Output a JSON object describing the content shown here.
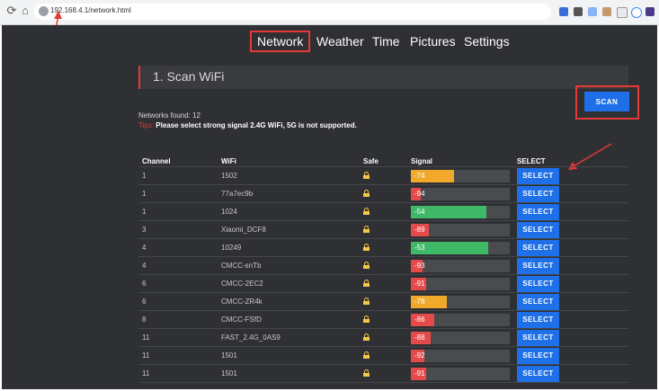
{
  "browser": {
    "url": "192.168.4.1/network.html",
    "back_icon": "back-icon",
    "home_icon": "home-icon"
  },
  "nav": {
    "items": [
      "Network",
      "Weather",
      "Time",
      "Pictures",
      "Settings"
    ],
    "active": "Network"
  },
  "section": {
    "title": "1. Scan WiFi",
    "scan_label": "SCAN"
  },
  "status": {
    "found": "Networks found: 12",
    "tips_label": "Tips:",
    "tips_text": " Please select strong signal 2.4G WiFi, 5G is not supported."
  },
  "table": {
    "headers": [
      "Channel",
      "WiFi",
      "Safe",
      "Signal",
      "SELECT"
    ],
    "rows": [
      {
        "channel": "1",
        "wifi": "1502",
        "signal": -74,
        "select": "SELECT"
      },
      {
        "channel": "1",
        "wifi": "77a7ec9b",
        "signal": -94,
        "select": "SELECT"
      },
      {
        "channel": "1",
        "wifi": "1024",
        "signal": -54,
        "select": "SELECT"
      },
      {
        "channel": "3",
        "wifi": "Xiaomi_DCF8",
        "signal": -89,
        "select": "SELECT"
      },
      {
        "channel": "4",
        "wifi": "10249",
        "signal": -53,
        "select": "SELECT"
      },
      {
        "channel": "4",
        "wifi": "CMCC-snTb",
        "signal": -93,
        "select": "SELECT"
      },
      {
        "channel": "6",
        "wifi": "CMCC-2EC2",
        "signal": -91,
        "select": "SELECT"
      },
      {
        "channel": "6",
        "wifi": "CMCC-ZR4k",
        "signal": -78,
        "select": "SELECT"
      },
      {
        "channel": "8",
        "wifi": "CMCC-FSfD",
        "signal": -86,
        "select": "SELECT"
      },
      {
        "channel": "11",
        "wifi": "FAST_2.4G_0AS9",
        "signal": -88,
        "select": "SELECT"
      },
      {
        "channel": "11",
        "wifi": "1501",
        "signal": -92,
        "select": "SELECT"
      },
      {
        "channel": "11",
        "wifi": "1501",
        "signal": -91,
        "select": "SELECT"
      }
    ]
  },
  "colors": {
    "good": "#3fb968",
    "medium": "#f0a92b",
    "bad": "#e54a4a",
    "accent": "#1e6fe8",
    "highlight": "#e53935"
  }
}
